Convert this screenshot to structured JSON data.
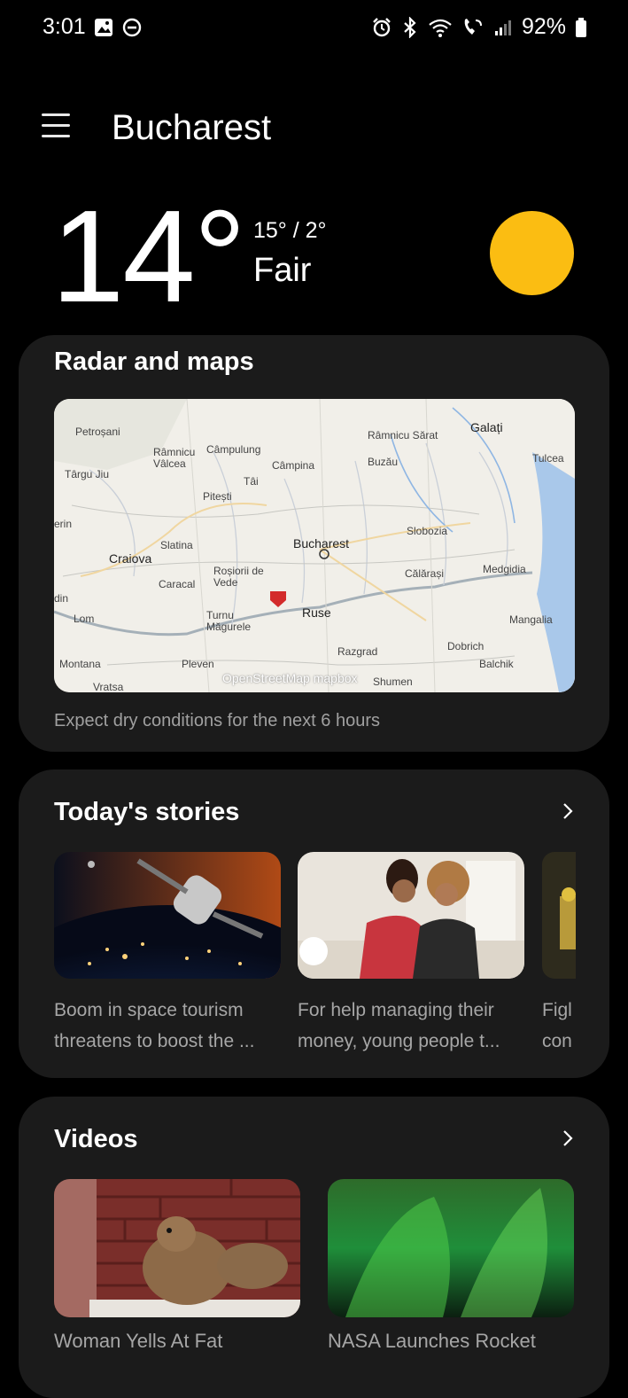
{
  "status_bar": {
    "time": "3:01",
    "battery": "92%",
    "left_icons": [
      "gallery-icon",
      "dnd-icon"
    ],
    "right_icons": [
      "alarm-icon",
      "bluetooth-icon",
      "wifi-icon",
      "wifi-calling-icon",
      "signal-icon",
      "battery-icon"
    ]
  },
  "header": {
    "city": "Bucharest",
    "menu_icon": "hamburger-menu-icon"
  },
  "current": {
    "temperature": "14°",
    "high_low": "15° / 2°",
    "condition": "Fair",
    "condition_icon": "sun-icon",
    "sun_color": "#fbbd12"
  },
  "radar": {
    "title": "Radar and maps",
    "message": "Expect dry conditions for the next 6 hours",
    "map_labels": [
      "Petroșani",
      "Râmnicu Vâlcea",
      "Câmpulung",
      "Târgu Jiu",
      "Pitești",
      "Câmpina",
      "Buzău",
      "Râmnicu Sărat",
      "Galați",
      "Tulcea",
      "Craiova",
      "Slatina",
      "Bucharest",
      "Slobozia",
      "Caracal",
      "Roșiorii de Vede",
      "Călărași",
      "Medgidia",
      "Lom",
      "Turnu Măgurele",
      "Ruse",
      "Mangalia",
      "Montana",
      "Pleven",
      "Razgrad",
      "Dobrich",
      "Balchik",
      "Vratsa",
      "Tâi",
      "erin",
      "din",
      "Shumen"
    ],
    "attribution": "OpenStreetMap  mapbox"
  },
  "stories": {
    "title": "Today's stories",
    "items": [
      {
        "line1": "Boom in space tourism",
        "line2": "threatens to boost the ..."
      },
      {
        "line1": "For help managing their",
        "line2": "money, young people t..."
      },
      {
        "line1": "Figl",
        "line2": "con"
      }
    ]
  },
  "videos": {
    "title": "Videos",
    "items": [
      {
        "title": "Woman Yells At Fat"
      },
      {
        "title": "NASA Launches Rocket"
      }
    ]
  }
}
